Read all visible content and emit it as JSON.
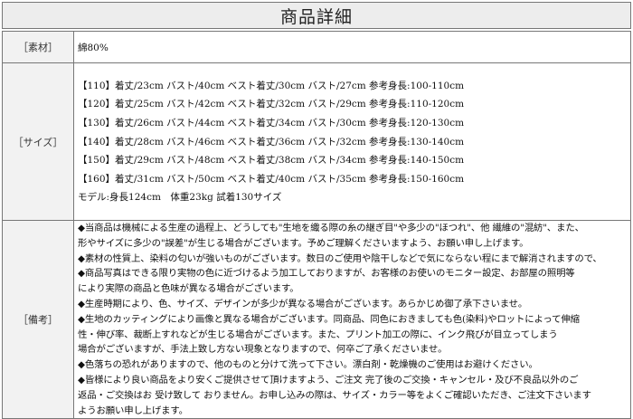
{
  "header": {
    "title": "商品詳細"
  },
  "material": {
    "label": "［素材］",
    "value": "綿80%"
  },
  "size": {
    "label": "［サイズ］",
    "lines": [
      "【110】着丈/23cm バスト/40cm ベスト着丈/30cm バスト/27cm 参考身長:100-110cm",
      "【120】着丈/25cm バスト/42cm ベスト着丈/32cm バスト/29cm 参考身長:110-120cm",
      "【130】着丈/26cm バスト/44cm ベスト着丈/34cm バスト/30cm 参考身長:120-130cm",
      "【140】着丈/28cm バスト/46cm ベスト着丈/36cm バスト/32cm 参考身長:130-140cm",
      "【150】着丈/29cm バスト/48cm ベスト着丈/38cm バスト/34cm 参考身長:140-150cm",
      "【160】着丈/31cm バスト/50cm ベスト着丈/40cm バスト/35cm 参考身長:150-160cm"
    ],
    "model": "モデル:身長124cm　体重23kg 試着130サイズ"
  },
  "notes": {
    "label": "［備考］",
    "lines": [
      "◆当商品は機械による生産の過程上、どうしても\"生地を織る際の糸の継ぎ目\"や多少の\"ほつれ\"、他 繊維の\"混紡\"、また、",
      "形やサイズに多少の\"誤差\"が生じる場合がございます。予めご理解くださいますよう、お願い申し上げます。",
      "◆素材の性質上、染料の匂いが強いものがございます。数日のご使用や陰干しなどで気にならない程にまで解消されますので、",
      "◆商品写真はできる限り実物の色に近づけるよう加工しておりますが、お客様のお使いのモニター設定、お部屋の照明等",
      "により実際の商品と色味が異なる場合がございます。",
      "◆生産時期により、色、サイズ、デザインが多少が異なる場合がございます。あらかじめ御了承下さいませ。",
      "◆生地のカッティングにより画像と異なる場合がございます。同商品、同色におきましても色(染料)やロットによって伸縮",
      "性・伸び率、裁断上すれなどが生じる場合がございます。また、プリント加工の際に、インク飛びが目立ってしまう",
      "場合がございますが、手法上致し方ない現象となりますので、何卒ご了承くださいませ。",
      "◆色落ちの恐れがありますので、他のものと分けて洗って下さい。漂白剤・乾燥機のご使用はお避けください。",
      "◆皆様により良い商品をより安くご提供させて頂けますよう、ご注文 完了後のご交換・キャンセル・及び不良品以外のご",
      "返品・ご交換はお 受け致して おりません。お申し込みの際は、サイズ・カラー等をよくご確認いただき、ご注文下さいます",
      "ようお願い申し上げます。"
    ]
  }
}
